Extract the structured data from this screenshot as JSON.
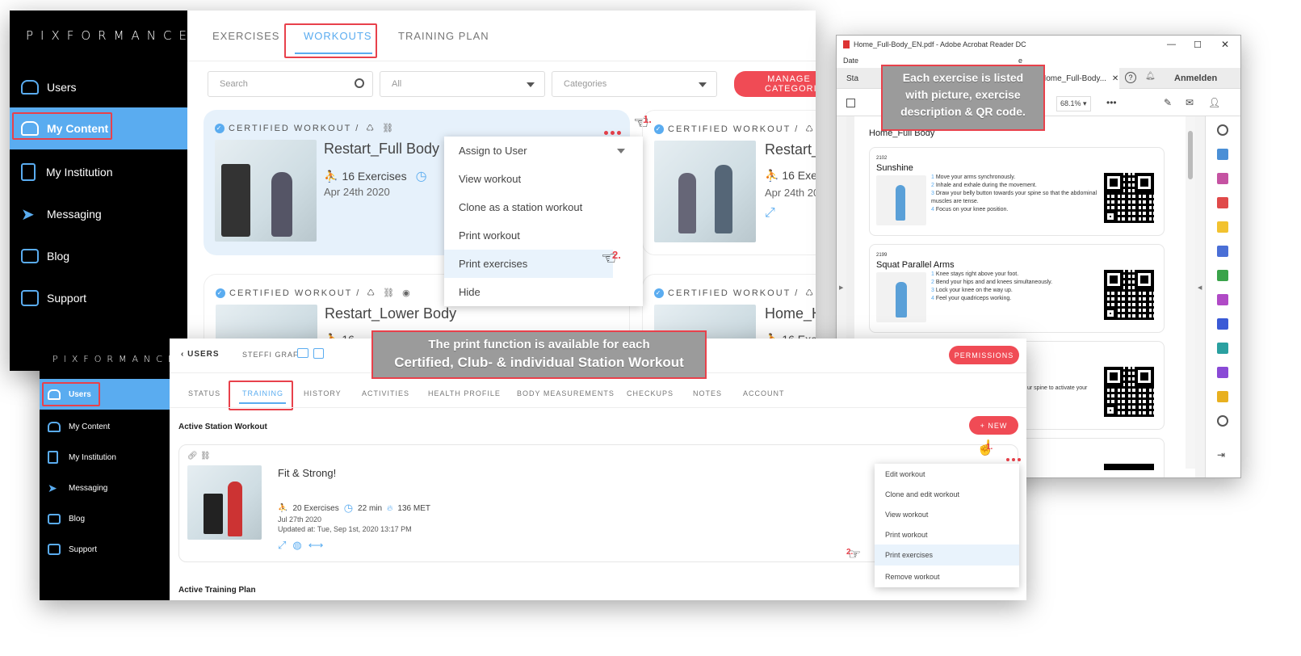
{
  "top_app": {
    "logo": "PIXFORMANCE",
    "sidebar": [
      {
        "label": "Users",
        "icon": "users-icon"
      },
      {
        "label": "My Content",
        "icon": "content-icon"
      },
      {
        "label": "My Institution",
        "icon": "institution-icon"
      },
      {
        "label": "Messaging",
        "icon": "messaging-icon"
      },
      {
        "label": "Blog",
        "icon": "blog-icon"
      },
      {
        "label": "Support",
        "icon": "support-icon"
      }
    ],
    "tabs": [
      "EXERCISES",
      "WORKOUTS",
      "TRAINING PLAN"
    ],
    "search_placeholder": "Search",
    "filter_all": "All",
    "filter_categories": "Categories",
    "manage_button": "MANAGE CATEGORIES",
    "cards": [
      {
        "badge": "CERTIFIED WORKOUT /",
        "title": "Restart_Full Body",
        "exercises": "16 Exercises",
        "date": "Apr 24th 2020"
      },
      {
        "badge": "CERTIFIED WORKOUT /",
        "title": "Restart_",
        "exercises": "16 Exe",
        "date": "Apr 24th 20"
      },
      {
        "badge": "CERTIFIED WORKOUT /",
        "title": "Restart_Lower Body",
        "exercises": "16",
        "date": ""
      },
      {
        "badge": "CERTIFIED WORKOUT /",
        "title": "Home_H",
        "exercises": "16 Exe",
        "date": ""
      }
    ],
    "menu": [
      "Assign to User",
      "View workout",
      "Clone as a station workout",
      "Print workout",
      "Print exercises",
      "Hide"
    ],
    "step1": "1.",
    "step2": "2."
  },
  "pdf_window": {
    "title": "Home_Full-Body_EN.pdf - Adobe Acrobat Reader DC",
    "menu_frag1": "Date",
    "menu_frag2": "e",
    "tab_left": "Sta",
    "tab_file": "Home_Full-Body...",
    "login": "Anmelden",
    "page_of": "/ 5",
    "zoom": "68.1%",
    "doc_title": "Home_Full Body",
    "exercises": [
      {
        "id": "2102",
        "name": "Sunshine",
        "steps": [
          "Move your arms synchronously.",
          "Inhale and exhale during the movement.",
          "Draw your belly button towards your spine so that the abdominal muscles are tense.",
          "Focus on your knee position."
        ]
      },
      {
        "id": "2199",
        "name": "Squat Parallel Arms",
        "steps": [
          "Knee stays right above your foot.",
          "Bend your hips and and knees simultaneously.",
          "Lock your knee on the way up.",
          "Feel your quadriceps working."
        ]
      },
      {
        "id": "",
        "name": "",
        "steps": [
          "ur spine to activate your"
        ]
      }
    ]
  },
  "callout_pdf": "Each exercise is listed with picture, exercise description & QR code.",
  "callout_print_line1": "The print function is available for each",
  "callout_print_line2": "Certified, Club- & individual Station Workout",
  "bottom_app": {
    "logo": "PIXFORMANCE",
    "sidebar": [
      "Users",
      "My Content",
      "My Institution",
      "Messaging",
      "Blog",
      "Support"
    ],
    "back": "USERS",
    "user_name": "STEFFI GRAF",
    "permissions": "PERMISSIONS",
    "tabs": [
      "STATUS",
      "TRAINING",
      "HISTORY",
      "ACTIVITIES",
      "HEALTH PROFILE",
      "BODY MEASUREMENTS",
      "CHECKUPS",
      "NOTES",
      "ACCOUNT"
    ],
    "section1": "Active Station Workout",
    "new_button": "+ NEW",
    "workout": {
      "title": "Fit & Strong!",
      "exercises": "20 Exercises",
      "duration": "22 min",
      "met": "136 MET",
      "date": "Jul 27th 2020",
      "updated": "Updated at: Tue, Sep 1st, 2020 13:17 PM"
    },
    "menu": [
      "Edit workout",
      "Clone and edit workout",
      "View workout",
      "Print workout",
      "Print exercises",
      "Remove workout"
    ],
    "section2": "Active Training Plan",
    "step1": "1.",
    "step2": "2."
  }
}
